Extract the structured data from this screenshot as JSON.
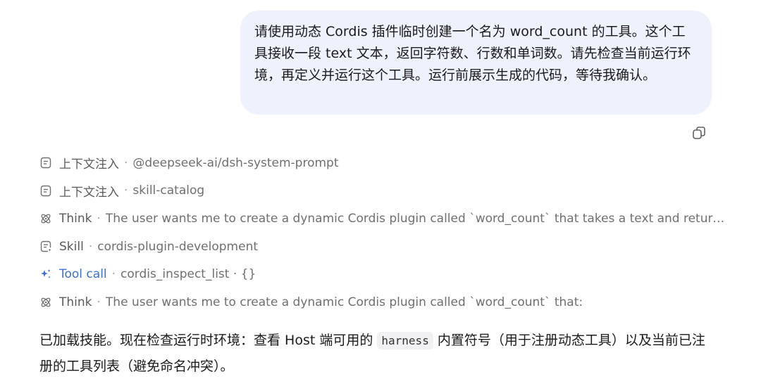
{
  "user_message": {
    "text": "请使用动态 Cordis 插件临时创建一个名为 word_count 的工具。这个工具接收一段 text 文本，返回字符数、行数和单词数。请先检查当前运行环境，再定义并运行这个工具。运行前展示生成的代码，等待我确认。"
  },
  "copy_button": {
    "icon": "copy-icon"
  },
  "steps": [
    {
      "icon": "document-icon",
      "kind": "上下文注入",
      "detail": "@deepseek-ai/dsh-system-prompt"
    },
    {
      "icon": "document-icon",
      "kind": "上下文注入",
      "detail": "skill-catalog"
    },
    {
      "icon": "think-icon",
      "kind": "Think",
      "detail": "The user wants me to create a dynamic Cordis plugin called `word_count` that takes a text and return..."
    },
    {
      "icon": "skill-icon",
      "kind": "Skill",
      "detail": "cordis-plugin-development"
    },
    {
      "icon": "sparkle-icon",
      "kind": "Tool call",
      "detail": "cordis_inspect_list · {}"
    },
    {
      "icon": "think-icon",
      "kind": "Think",
      "detail": "The user wants me to create a dynamic Cordis plugin called `word_count` that:"
    }
  ],
  "separator": "·",
  "assistant_answer": {
    "before": "已加载技能。现在检查运行时环境：查看 Host 端可用的 ",
    "code": "harness",
    "after": " 内置符号（用于注册动态工具）以及当前已注册的工具列表（避免命名冲突）。"
  },
  "colors": {
    "bubble_bg": "#eef2fd",
    "accent_blue": "#3a6fd8",
    "muted_text": "#6b6b6b"
  }
}
